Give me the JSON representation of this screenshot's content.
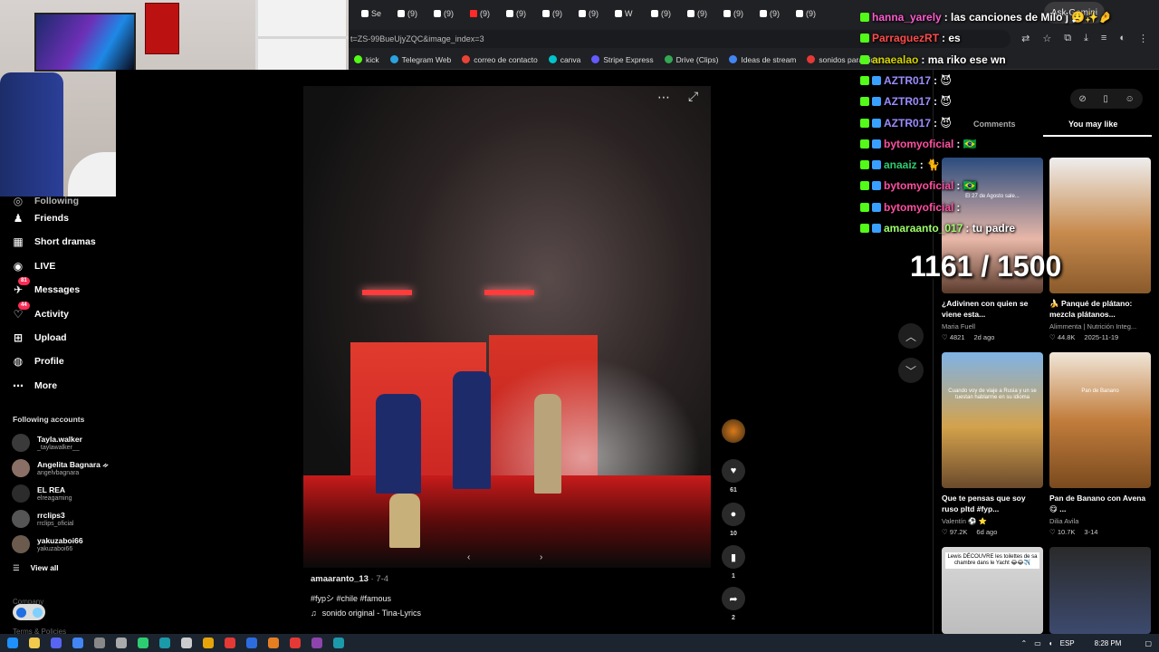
{
  "browser": {
    "tabs": [
      {
        "label": "Se",
        "icon": "tiktok-icon"
      },
      {
        "label": "(9)",
        "icon": "tiktok-icon"
      },
      {
        "label": "(9)",
        "icon": "tiktok-icon"
      },
      {
        "label": "(9)",
        "icon": "youtube-icon"
      },
      {
        "label": "(9)",
        "icon": "tiktok-icon"
      },
      {
        "label": "(9)",
        "icon": "tiktok-icon"
      },
      {
        "label": "(9)",
        "icon": "tiktok-icon"
      },
      {
        "label": "W",
        "icon": "tiktok-icon"
      },
      {
        "label": "(9)",
        "icon": "tiktok-icon"
      },
      {
        "label": "(9)",
        "icon": "tiktok-icon"
      },
      {
        "label": "(9)",
        "icon": "tiktok-icon"
      },
      {
        "label": "(9)",
        "icon": "tiktok-icon"
      },
      {
        "label": "(9)",
        "icon": "tiktok-icon"
      }
    ],
    "ask_gemini": "Ask Gemini",
    "url": "t=ZS-99BueUjyZQC&image_index=3",
    "bookmarks": [
      {
        "label": "kick",
        "color": "#53fc18"
      },
      {
        "label": "Telegram Web",
        "color": "#2aa3df"
      },
      {
        "label": "correo de contacto",
        "color": "#ea4335"
      },
      {
        "label": "canva",
        "color": "#00c4cc"
      },
      {
        "label": "Stripe Express",
        "color": "#635bff"
      },
      {
        "label": "Drive (Clips)",
        "color": "#34a853"
      },
      {
        "label": "Ideas de stream",
        "color": "#4285f4"
      },
      {
        "label": "sonidos para videos",
        "color": "#e53935"
      }
    ]
  },
  "nav": {
    "following_partial": "Following",
    "items": [
      {
        "label": "Friends",
        "icon": "friends-icon"
      },
      {
        "label": "Short dramas",
        "icon": "short-dramas-icon"
      },
      {
        "label": "LIVE",
        "icon": "live-icon"
      },
      {
        "label": "Messages",
        "icon": "messages-icon",
        "badge": "81"
      },
      {
        "label": "Activity",
        "icon": "activity-icon",
        "badge": "44"
      },
      {
        "label": "Upload",
        "icon": "upload-icon"
      },
      {
        "label": "Profile",
        "icon": "profile-icon"
      },
      {
        "label": "More",
        "icon": "more-icon"
      }
    ],
    "following_accounts_header": "Following accounts",
    "accounts": [
      {
        "name": "Tayla.walker",
        "username": "_taylawalker__"
      },
      {
        "name": "Angelita Bagnara ᨀ",
        "username": "angelvbagnara"
      },
      {
        "name": "EL REA",
        "username": "elreagaming"
      },
      {
        "name": "rrclips3",
        "username": "rrclips_oficial"
      },
      {
        "name": "yakuzaboi66",
        "username": "yakuzaboi66"
      }
    ],
    "view_all": "View all",
    "company": "Company",
    "terms": "Terms & Policies"
  },
  "post": {
    "author": "amaaranto_13",
    "date": "7-4",
    "hashtags": "#fypシ #chile #famous",
    "sound": "sonido original - Tina-Lyrics",
    "likes": "61",
    "comments": "10",
    "saves": "1",
    "shares": "2"
  },
  "right_panel": {
    "tab_comments": "Comments",
    "tab_you_may_like": "You may like",
    "cards": [
      {
        "title": "¿Adivinen con quien se viene esta...",
        "author": "Maria Fuell",
        "likes": "4821",
        "date": "2d ago",
        "thumb_text": "El 27 de Agosto sale..."
      },
      {
        "title": "🍌 Panqué de plátano: mezcla plátanos...",
        "author": "Alimmenta | Nutrición Integ...",
        "likes": "44.8K",
        "date": "2025-11-19",
        "thumb_text": ""
      },
      {
        "title": "Que te pensas que soy ruso pltd #fyp...",
        "author": "Valentín ⚽ ⭐",
        "likes": "97.2K",
        "date": "6d ago",
        "thumb_text": "Cuando voy de viaje a Rusia y un se tuestan hablarme en su idioma"
      },
      {
        "title": "Pan de Banano con Avena 😋 ...",
        "author": "Dilia Avila",
        "likes": "10.7K",
        "date": "3-14",
        "thumb_text": "Pan de Banano"
      },
      {
        "title": "",
        "author": "",
        "likes": "",
        "date": "",
        "thumb_text": "Lewis DÉCOUVRE les toilettes de sa chambre dans le Yacht 😂😂✈️"
      },
      {
        "title": "",
        "author": "",
        "likes": "",
        "date": "",
        "thumb_text": ""
      }
    ]
  },
  "chat": [
    {
      "user": "hanna_yarely",
      "text": ": las canciones de Milo j 😮‍💨✨🤌",
      "color": "#ff5bd0"
    },
    {
      "user": "ParraguezRT",
      "text": ": es",
      "color": "#ff4b4b"
    },
    {
      "user": "anaealao",
      "text": ": ma riko ese wn",
      "color": "#d4d400"
    },
    {
      "user": "AZTR017",
      "text": ": 😈",
      "color": "#9b8cff"
    },
    {
      "user": "AZTR017",
      "text": ": 😈",
      "color": "#9b8cff"
    },
    {
      "user": "AZTR017",
      "text": ": 😈",
      "color": "#9b8cff"
    },
    {
      "user": "bytomyoficial",
      "text": ": 🇧🇷",
      "color": "#ff4fa0"
    },
    {
      "user": "anaaiz",
      "text": ": 🐈",
      "color": "#2ecc71"
    },
    {
      "user": "bytomyoficial",
      "text": ": 🇧🇷",
      "color": "#ff4fa0"
    },
    {
      "user": "bytomyoficial",
      "text": ":",
      "color": "#ff4fa0"
    },
    {
      "user": "amaraanto_017",
      "text": ": tu padre",
      "color": "#9eff6a"
    }
  ],
  "counter": "1161 / 1500",
  "taskbar": {
    "language": "ESP",
    "time": "8:28 PM"
  }
}
